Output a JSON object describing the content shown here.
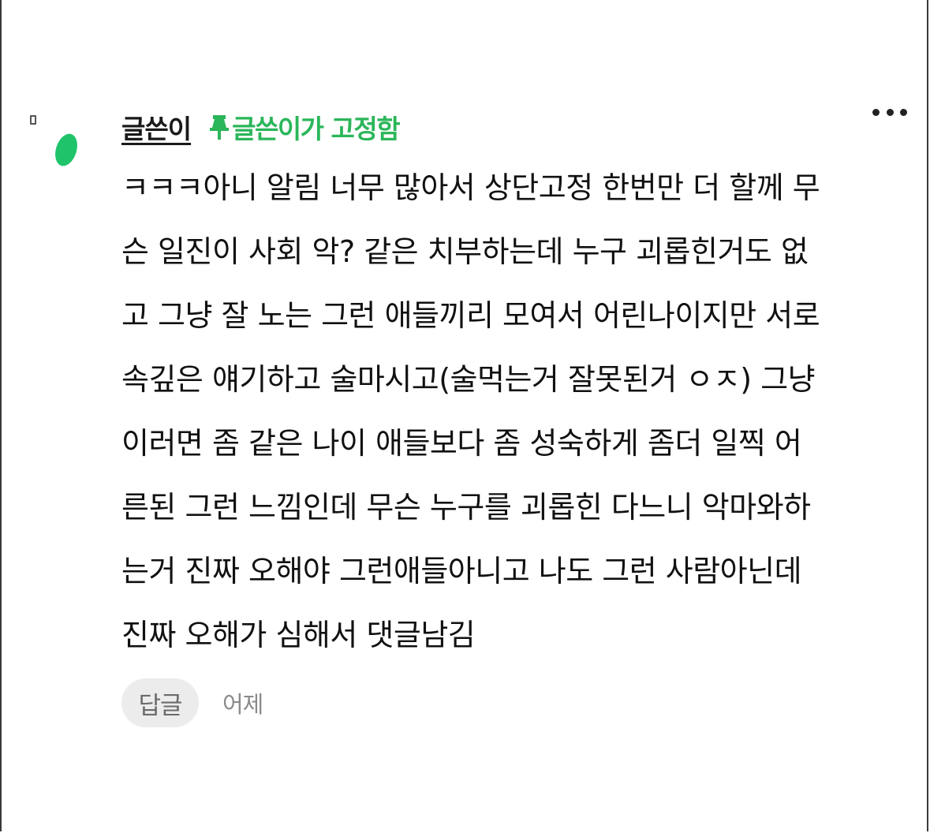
{
  "comment": {
    "author": "글쓴이",
    "pinned_label": "글쓴이가 고정함",
    "body_lines": [
      "ㅋㅋㅋ아니 알림 너무 많아서 상단고정 한번만 더 할께 무",
      "슨 일진이 사회 악? 같은 치부하는데 누구 괴롭힌거도 없",
      "고 그냥 잘 노는 그런 애들끼리 모여서 어린나이지만 서로",
      "속깊은 얘기하고 술마시고(술먹는거 잘못된거 ㅇㅈ) 그냥",
      "이러면 좀 같은 나이 애들보다 좀 성숙하게 좀더 일찍 어",
      "른된 그런 느낌인데 무슨 누구를 괴롭힌 다느니 악마와하",
      "는거 진짜 오해야 그런애들아니고 나도 그런 사람아닌데",
      "진짜 오해가 심해서 댓글남김"
    ],
    "reply_label": "답글",
    "timestamp": "어제"
  },
  "colors": {
    "pinned_green": "#2bb65a",
    "avatar_green": "#1fc46a",
    "reply_bg": "#ececec"
  },
  "icons": {
    "pin": "pin-icon",
    "more": "more-dots-icon",
    "avatar": "avatar-icon"
  }
}
